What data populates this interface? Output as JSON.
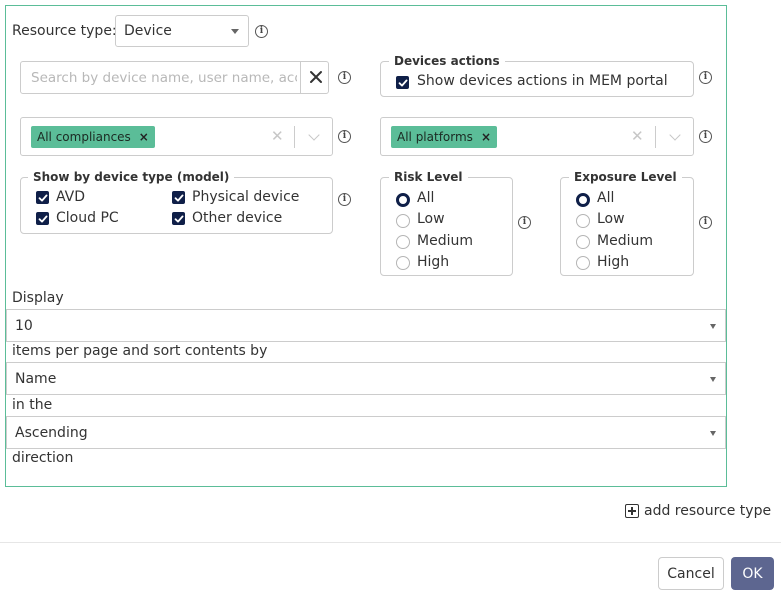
{
  "resource_type": {
    "label": "Resource type:",
    "selected": "Device"
  },
  "search": {
    "placeholder": "Search by device name, user name, account",
    "value": ""
  },
  "devices_actions": {
    "legend": "Devices actions",
    "option": "Show devices actions in MEM portal",
    "checked": true
  },
  "compliances": {
    "chip": "All compliances"
  },
  "platforms": {
    "chip": "All platforms"
  },
  "device_type": {
    "legend": "Show by device type (model)",
    "options": [
      {
        "label": "AVD",
        "checked": true
      },
      {
        "label": "Physical device",
        "checked": true
      },
      {
        "label": "Cloud PC",
        "checked": true
      },
      {
        "label": "Other device",
        "checked": true
      }
    ]
  },
  "risk_level": {
    "legend": "Risk Level",
    "options": [
      "All",
      "Low",
      "Medium",
      "High"
    ],
    "selected": "All"
  },
  "exposure_level": {
    "legend": "Exposure Level",
    "options": [
      "All",
      "Low",
      "Medium",
      "High"
    ],
    "selected": "All"
  },
  "display": {
    "display_label": "Display",
    "page_size": "10",
    "per_page_label": "items per page and sort contents by",
    "sort_by": "Name",
    "in_the_label": "in the",
    "direction": "Ascending",
    "direction_label": "direction"
  },
  "add_resource_type": "add resource type",
  "footer": {
    "cancel": "Cancel",
    "ok": "OK"
  },
  "colors": {
    "accent": "#5bbd98",
    "primary": "#0f1f48",
    "ok_button": "#5d6690"
  }
}
